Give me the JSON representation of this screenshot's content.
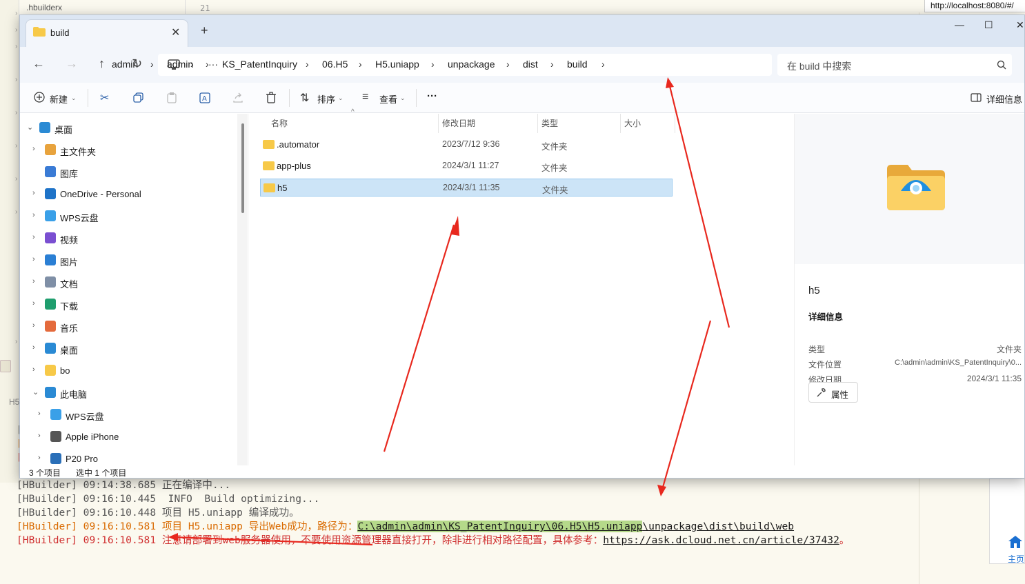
{
  "ide": {
    "tree_item": ".hbuilderx",
    "line_number": "21",
    "left_label": "H5",
    "console": [
      {
        "prefix": "[HBuilder]",
        "time": "09:14:38.685",
        "text": " 正在编译中...",
        "color": "gray"
      },
      {
        "prefix": "[HBuilder]",
        "time": "09:16:10.445",
        "text": "  INFO  Build optimizing...",
        "color": "gray"
      },
      {
        "prefix": "[HBuilder]",
        "time": "09:16:10.448",
        "text": " 项目 H5.uniapp 编译成功。",
        "color": "gray"
      },
      {
        "prefix": "[HBuilder]",
        "time": "09:16:10.581",
        "text": " 项目 H5.uniapp 导出Web成功，路径为：",
        "path_highlight": "C:\\admin\\admin\\KS_PatentInquiry\\06.H5\\H5.uniapp",
        "path_rest": "\\unpackage\\dist\\build\\web",
        "color": "orange"
      },
      {
        "prefix": "[HBuilder]",
        "time": "09:16:10.581",
        "text": " 注意请部署到web服务器使用，不要使用资源管理器直接打开，除非进行相对路径配置，具体参考：",
        "link": "https://ask.dcloud.net.cn/article/37432",
        "suffix": "。",
        "color": "red"
      }
    ]
  },
  "browser": {
    "url": "http://localhost:8080/#/",
    "home_label": "主页"
  },
  "explorer": {
    "tab_title": "build",
    "new_tab": "+",
    "window_controls": {
      "minimize": "—",
      "maximize": "☐",
      "close": "✕"
    },
    "breadcrumb": [
      "admin",
      "admin",
      "KS_PatentInquiry",
      "06.H5",
      "H5.uniapp",
      "unpackage",
      "dist",
      "build"
    ],
    "ellipsis": "···",
    "search_placeholder": "在 build 中搜索",
    "toolbar": {
      "new_label": "新建",
      "sort_label": "排序",
      "view_label": "查看",
      "more": "···",
      "details_label": "详细信息"
    },
    "nav": [
      {
        "label": "桌面",
        "icon": "desktop-icon",
        "color": "#2a8ad4",
        "indent": 0,
        "chev": "⌄"
      },
      {
        "label": "主文件夹",
        "icon": "home-icon",
        "color": "#e8a33d",
        "indent": 1,
        "chev": "›"
      },
      {
        "label": "图库",
        "icon": "gallery-icon",
        "color": "#3a7bd5",
        "indent": 1,
        "chev": ""
      },
      {
        "label": "OneDrive - Personal",
        "icon": "cloud-icon",
        "color": "#1e73c8",
        "indent": 1,
        "chev": "›"
      },
      {
        "label": "WPS云盘",
        "icon": "cloud-icon",
        "color": "#3aa0e8",
        "indent": 1,
        "chev": "›"
      },
      {
        "label": "视频",
        "icon": "video-icon",
        "color": "#7a4fd1",
        "indent": 1,
        "chev": "›"
      },
      {
        "label": "图片",
        "icon": "picture-icon",
        "color": "#2b7fd4",
        "indent": 1,
        "chev": "›"
      },
      {
        "label": "文档",
        "icon": "document-icon",
        "color": "#7f8fa6",
        "indent": 1,
        "chev": "›"
      },
      {
        "label": "下载",
        "icon": "download-icon",
        "color": "#1f9e6e",
        "indent": 1,
        "chev": "›"
      },
      {
        "label": "音乐",
        "icon": "music-icon",
        "color": "#e46a3c",
        "indent": 1,
        "chev": "›"
      },
      {
        "label": "桌面",
        "icon": "desktop-icon",
        "color": "#2a8ad4",
        "indent": 1,
        "chev": "›"
      },
      {
        "label": "bo",
        "icon": "folder-icon",
        "color": "#f7c948",
        "indent": 1,
        "chev": "›"
      },
      {
        "label": "此电脑",
        "icon": "computer-icon",
        "color": "#2a8ad4",
        "indent": 1,
        "chev": "⌄"
      },
      {
        "label": "WPS云盘",
        "icon": "cloud-icon",
        "color": "#3aa0e8",
        "indent": 2,
        "chev": "›"
      },
      {
        "label": "Apple iPhone",
        "icon": "phone-icon",
        "color": "#555555",
        "indent": 2,
        "chev": "›"
      },
      {
        "label": "P20 Pro",
        "icon": "phone-icon",
        "color": "#2a6fb8",
        "indent": 2,
        "chev": "›"
      }
    ],
    "columns": {
      "name": "名称",
      "date": "修改日期",
      "type": "类型",
      "size": "大小"
    },
    "files": [
      {
        "name": ".automator",
        "date": "2023/7/12 9:36",
        "type": "文件夹",
        "selected": false
      },
      {
        "name": "app-plus",
        "date": "2024/3/1 11:27",
        "type": "文件夹",
        "selected": false
      },
      {
        "name": "h5",
        "date": "2024/3/1 11:35",
        "type": "文件夹",
        "selected": true
      }
    ],
    "details": {
      "name": "h5",
      "heading": "详细信息",
      "type_label": "类型",
      "type_value": "文件夹",
      "location_label": "文件位置",
      "location_value": "C:\\admin\\admin\\KS_PatentInquiry\\0...",
      "modified_label": "修改日期",
      "modified_value": "2024/3/1 11:35",
      "properties_label": "属性"
    },
    "status": {
      "count": "3 个项目",
      "selected": "选中 1 个项目"
    }
  },
  "colors": {
    "arrow": "#e8281e",
    "selection": "#cce4f7",
    "folder": "#f7c948"
  }
}
